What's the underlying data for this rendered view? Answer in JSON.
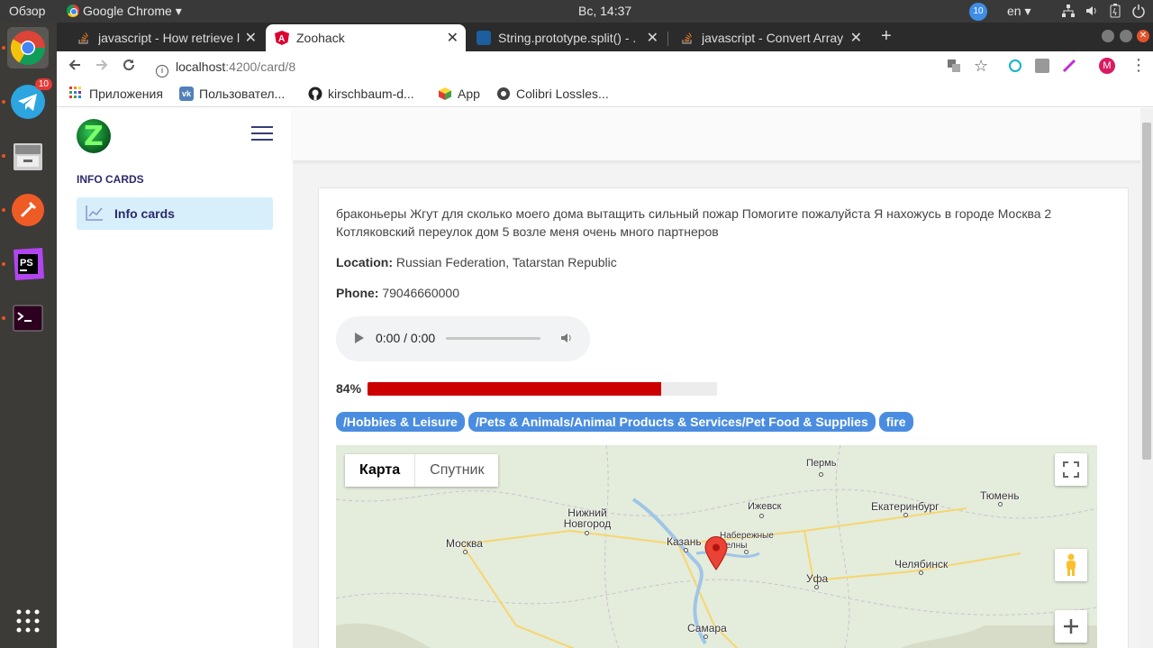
{
  "topbar": {
    "overview": "Обзор",
    "app": "Google Chrome",
    "clock": "Вс, 14:37",
    "notif_count": "10",
    "lang": "en"
  },
  "launcher": {
    "telegram_badge": "10",
    "items": [
      "chrome-icon",
      "telegram-icon",
      "files-icon",
      "postman-icon",
      "phpstorm-icon",
      "terminal-icon",
      "apps-grid-icon"
    ]
  },
  "tabs": [
    {
      "title": "javascript - How retrieve l",
      "icon": "stackoverflow-icon"
    },
    {
      "title": "Zoohack",
      "icon": "angular-icon"
    },
    {
      "title": "String.prototype.split() - .",
      "icon": "mdn-icon"
    },
    {
      "title": "javascript - Convert Array",
      "icon": "stackoverflow-icon"
    }
  ],
  "toolbar": {
    "url_host": "localhost",
    "url_path": ":4200/card/8",
    "avatar_letter": "M"
  },
  "bookmarks": [
    {
      "label": "Приложения",
      "icon": "apps-icon"
    },
    {
      "label": "Пользовател...",
      "icon": "vk-icon"
    },
    {
      "label": "kirschbaum-d...",
      "icon": "github-icon"
    },
    {
      "label": "App",
      "icon": "cube-icon"
    },
    {
      "label": "Colibri Lossles...",
      "icon": "colibri-icon"
    }
  ],
  "sidebar": {
    "section_title": "INFO CARDS",
    "item_label": "Info cards"
  },
  "card": {
    "description": "браконьеры Жгут для сколько моего дома вытащить сильный пожар Помогите пожалуйста Я нахожусь в городе Москва 2 Котляковский переулок дом 5 возле меня очень много партнеров",
    "location_label": "Location:",
    "location_value": "Russian Federation, Tatarstan Republic",
    "phone_label": "Phone:",
    "phone_value": "79046660000",
    "audio_time": "0:00 / 0:00",
    "progress_label": "84%",
    "progress_fraction": 0.84,
    "progress_color": "#cc0000",
    "tags": [
      "/Hobbies & Leisure",
      "/Pets & Animals/Animal Products & Services/Pet Food & Supplies",
      "fire"
    ],
    "tag_color": "#4a8de0"
  },
  "map": {
    "type_map": "Карта",
    "type_satellite": "Спутник",
    "cities": [
      {
        "name": "Пермь"
      },
      {
        "name": "Ижевск"
      },
      {
        "name": "Екатеринбург"
      },
      {
        "name": "Тюмень"
      },
      {
        "name": "Нижний Новгород"
      },
      {
        "name": "Москва"
      },
      {
        "name": "Казань"
      },
      {
        "name": "Набережные Челны"
      },
      {
        "name": "Уфа"
      },
      {
        "name": "Челябинск"
      },
      {
        "name": "Самара"
      }
    ]
  }
}
